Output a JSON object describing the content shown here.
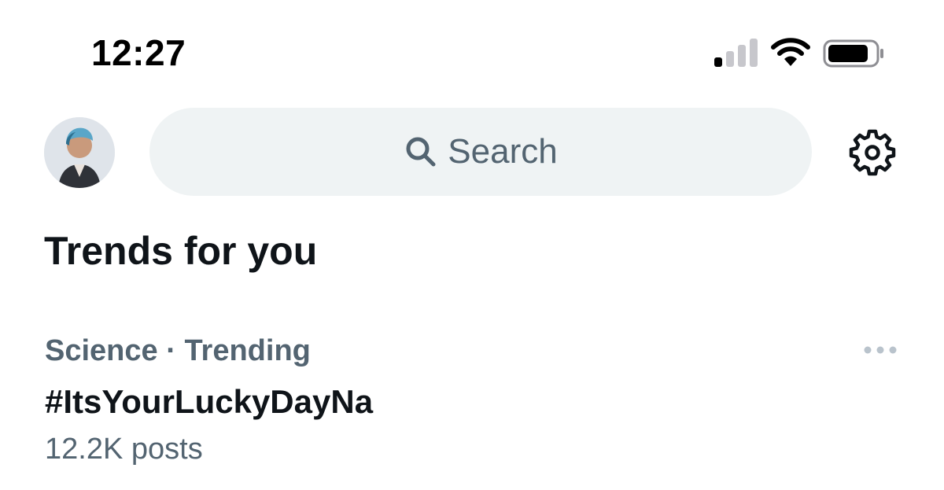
{
  "status_bar": {
    "time": "12:27",
    "icons": [
      "signal-icon",
      "wifi-icon",
      "battery-icon"
    ]
  },
  "header": {
    "avatar_icon": "profile-avatar",
    "search": {
      "placeholder": "Search",
      "icon": "search-icon"
    },
    "settings_icon": "gear-icon"
  },
  "trends": {
    "title": "Trends for you",
    "items": [
      {
        "category": "Science",
        "separator": "·",
        "status": "Trending",
        "name": "#ItsYourLuckyDayNa",
        "posts": "12.2K posts",
        "more_icon": "more-horizontal-icon"
      }
    ]
  },
  "colors": {
    "primary_text": "#0f1419",
    "secondary_text": "#536471",
    "search_bg": "#eff3f4",
    "background": "#ffffff"
  }
}
